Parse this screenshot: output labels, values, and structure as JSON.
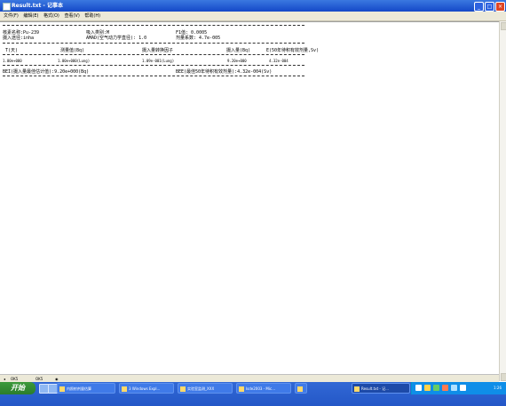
{
  "window": {
    "title": "Result.txt - 记事本",
    "minimize": "_",
    "maximize": "□",
    "close": "×"
  },
  "menu": [
    "文件(F)",
    "编辑(E)",
    "格式(O)",
    "查看(V)",
    "帮助(H)"
  ],
  "document": {
    "separator": "------------------------------------------------------------",
    "header_left_1": "核素名称:Pu-239",
    "header_mid_1": "吸入类别:M",
    "header_right_1": "F1值: 0.0005",
    "header_left_2": "摄入途径:inha",
    "header_mid_2": "AMAD(空气动力学直径): 1.0",
    "header_right_2": "剂量系数: 4.7e-005",
    "columns": [
      "T(天)",
      "测量值(Bq)",
      "摄入量转换因子",
      "摄入量(Bq)",
      "E(50年待积有效剂量,Sv)"
    ],
    "row": [
      "1.00e+000",
      "1.00e+000(Lung)",
      "1.09e-001(Lung)",
      "9.20e+000",
      "4.32e-004"
    ],
    "summary_left": "BEI(摄入量最佳估计值):9.20e+000(Bq)",
    "summary_right": "BEE(最佳50年待积有效剂量):4.32e-004(Sv)"
  },
  "sheet_tabs": [
    "OK5",
    "OK5"
  ],
  "taskbar": {
    "start": "开始",
    "tasks": [
      "内照射剂量估算",
      "3 Windows Expl...",
      "实验室监测_XXX",
      "Isde2003 - Mic...",
      "",
      "Result.txt - 记..."
    ],
    "clock": "1:26"
  }
}
